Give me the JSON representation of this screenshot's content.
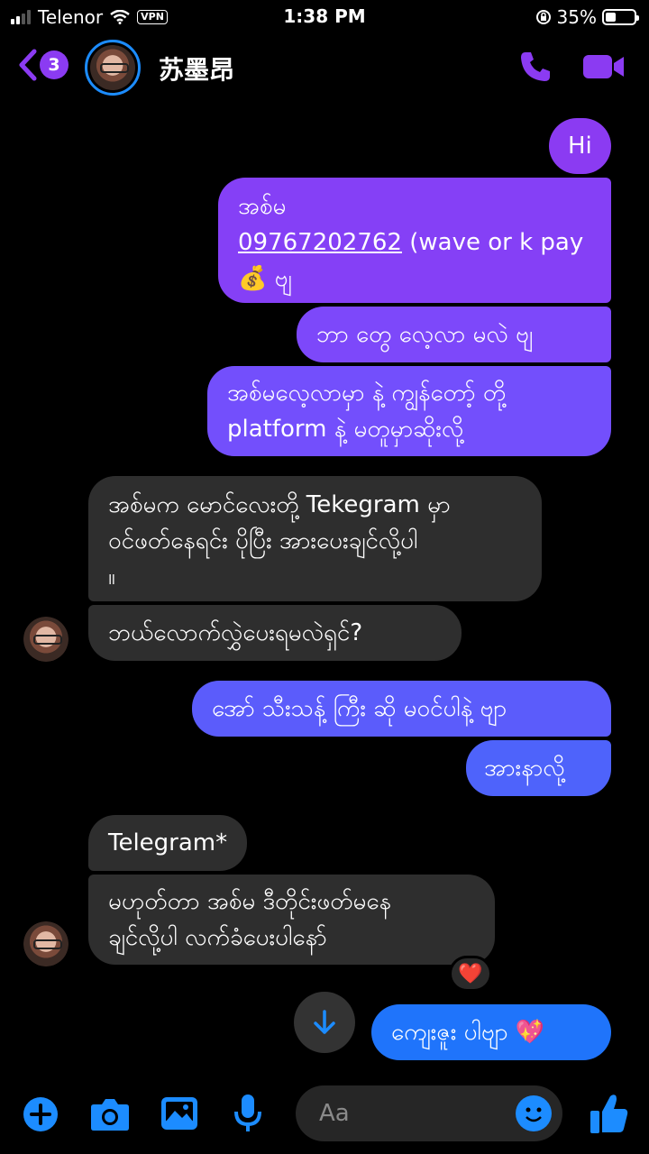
{
  "status_bar": {
    "carrier": "Telenor",
    "vpn": "VPN",
    "time": "1:38 PM",
    "battery": "35%",
    "battery_level": 0.35
  },
  "header": {
    "badge_count": "3",
    "contact_name": "苏墨昂",
    "accent_color": "#8b3bf2"
  },
  "messages": {
    "m1": "Hi",
    "m2_line1": "အစ်မ",
    "m2_phone": "09767202762",
    "m2_rest": " (wave or k pay",
    "m2_emoji": "💰",
    "m2_tail": " ဗျ",
    "m3": "ဘာ တွေ လေ့လာ မလဲ ဗျ",
    "m4_line1": "အစ်မလေ့လာမှာ နဲ့ ကျွန်တော့် တို့",
    "m4_line2": "platform နဲ့ မတူမှာဆိုးလို့",
    "m5_line1": "အစ်မက မောင်လေးတို့ Tekegram မှာ",
    "m5_line2": "ဝင်ဖတ်နေရင်း ပိုပြီး အားပေးချင်လို့ပါ",
    "m5_line3": "။",
    "m6": "ဘယ်လောက်လွှဲပေးရမလဲရှင်?",
    "m7": "အော် သီးသန့် ကြီး ဆို မဝင်ပါနဲ့ ဗျာ",
    "m8": "အားနာလို့",
    "m9": "Telegram*",
    "m10_line1": "မဟုတ်တာ အစ်မ ဒီတိုင်းဖတ်မနေ",
    "m10_line2": "ချင်လို့ပါ လက်ခံပေးပါနော်",
    "m10_reaction": "❤️",
    "m11": "ကျေးဇူး ပါဗျာ",
    "m11_emoji": "💖"
  },
  "composer": {
    "placeholder": "Aa"
  }
}
